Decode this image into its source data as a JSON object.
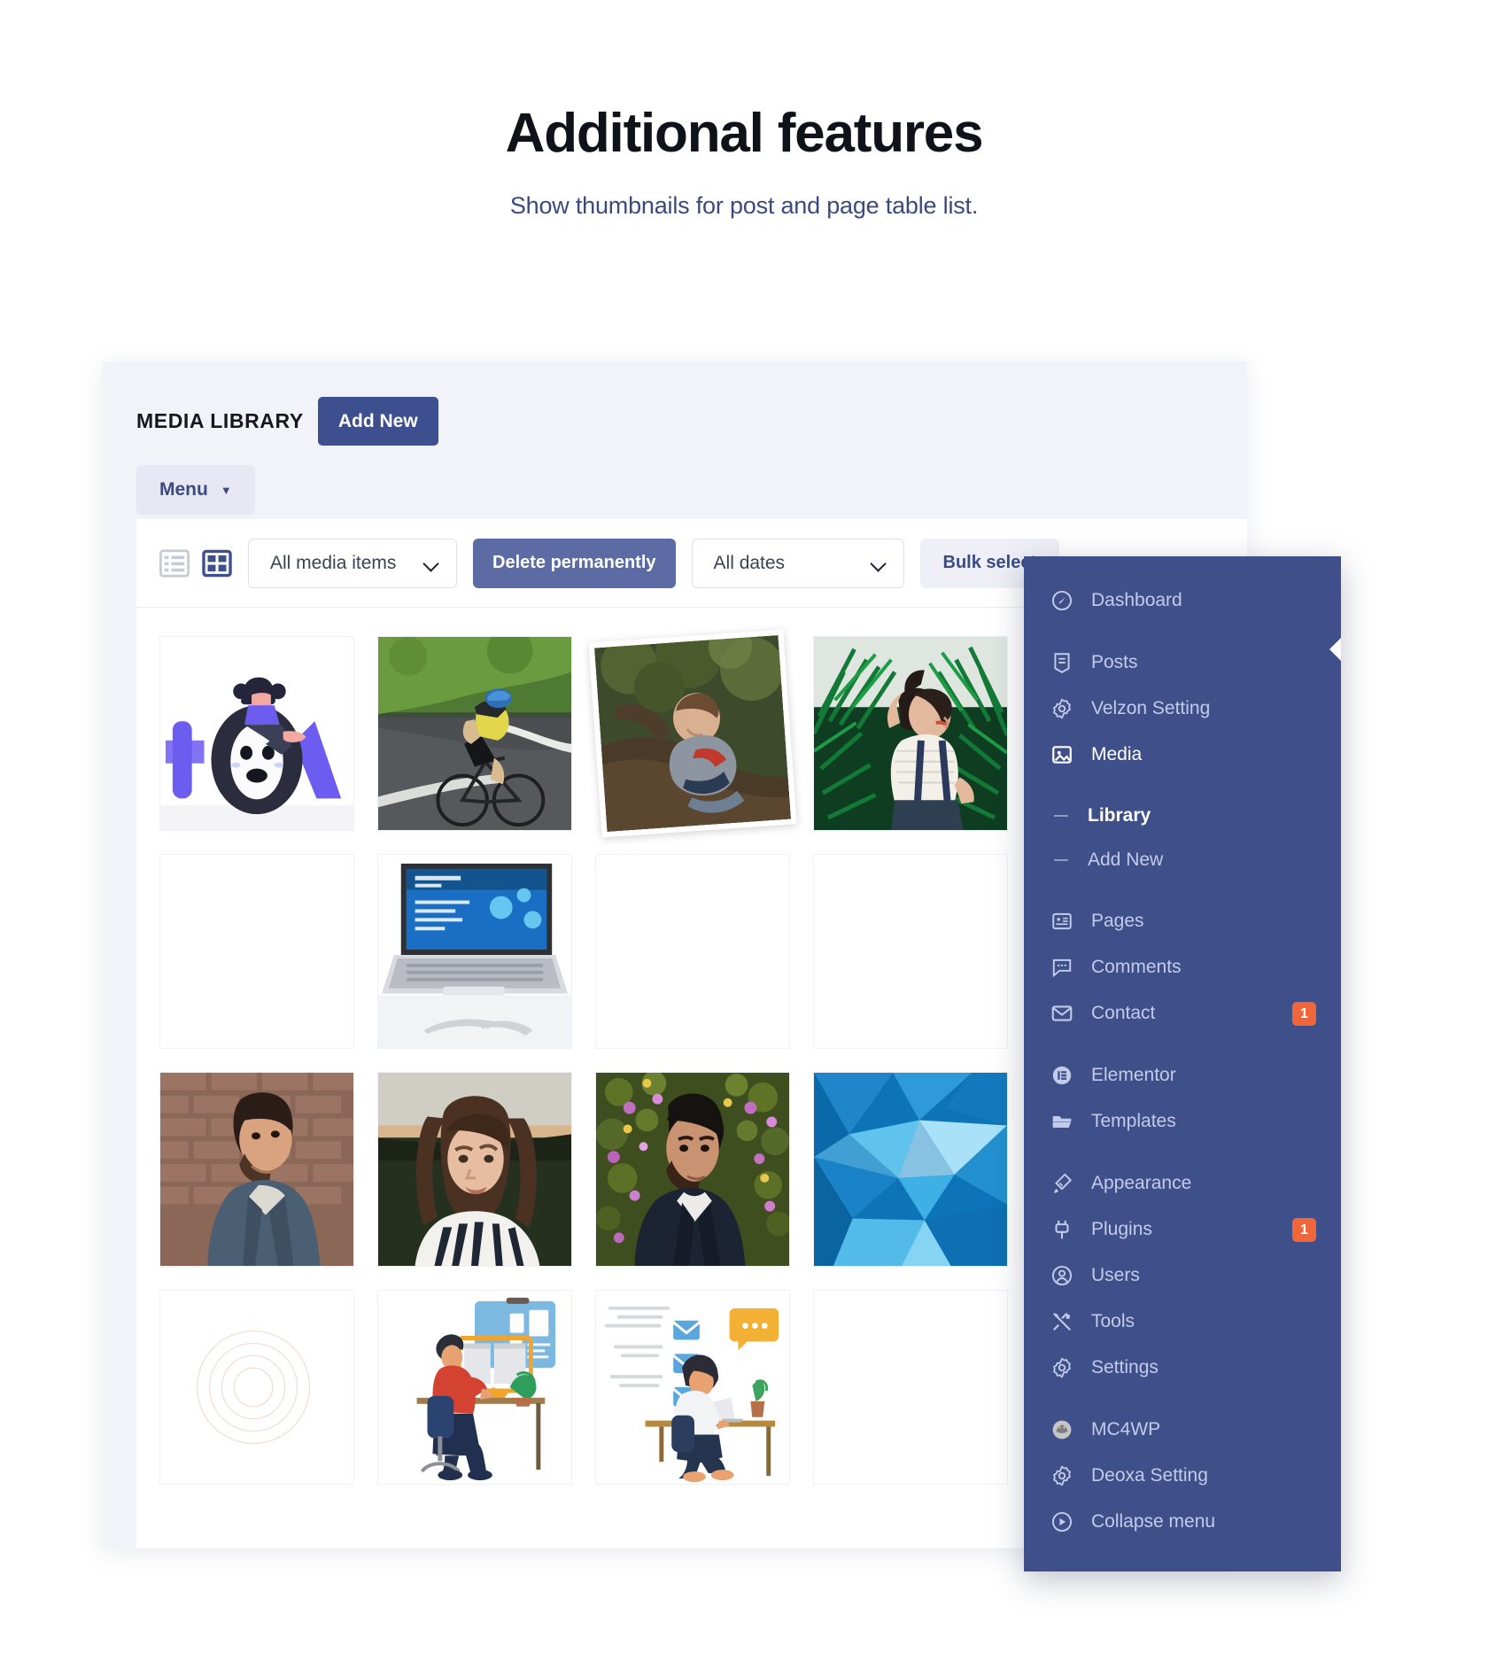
{
  "hero": {
    "title": "Additional features",
    "subtitle": "Show thumbnails for post and page table list."
  },
  "colors": {
    "brand": "#3e4f8f",
    "sidebar": "#3f4f8a",
    "badge": "#f1653a",
    "panel_bg": "#f2f3f9",
    "subtitle": "#3b4a7e"
  },
  "screenshot": {
    "header": {
      "title": "MEDIA LIBRARY",
      "add_new_label": "Add New",
      "menu_label": "Menu"
    },
    "filters": {
      "view_list_icon": "list-view-icon",
      "view_grid_icon": "grid-view-icon",
      "media_filter_value": "All media items",
      "delete_label": "Delete permanently",
      "dates_filter_value": "All dates",
      "bulk_select_label": "Bulk select"
    },
    "grid": {
      "items": [
        {
          "name": "illustration-404-character",
          "type": "illustration"
        },
        {
          "name": "photo-cyclist-road",
          "type": "photo"
        },
        {
          "name": "photo-boy-on-tree",
          "type": "photo",
          "tilted": true
        },
        {
          "name": "photo-woman-in-palms",
          "type": "photo"
        },
        {
          "name": "thumbnail-blank-1",
          "type": "blank"
        },
        {
          "name": "thumbnail-blank-2",
          "type": "blank"
        },
        {
          "name": "photo-laptop-mockup",
          "type": "photo"
        },
        {
          "name": "thumbnail-blank-3",
          "type": "blank"
        },
        {
          "name": "thumbnail-blank-4",
          "type": "blank"
        },
        {
          "name": "thumbnail-blank-5",
          "type": "blank"
        },
        {
          "name": "photo-man-brick-wall",
          "type": "photo"
        },
        {
          "name": "photo-woman-portrait",
          "type": "photo"
        },
        {
          "name": "photo-man-flowers",
          "type": "photo"
        },
        {
          "name": "photo-blue-abstract-polygons",
          "type": "photo"
        },
        {
          "name": "thumbnail-blank-6",
          "type": "blank"
        },
        {
          "name": "thumbnail-faint-circles",
          "type": "blank"
        },
        {
          "name": "illustration-man-at-desk",
          "type": "illustration"
        },
        {
          "name": "illustration-woman-at-desk",
          "type": "illustration"
        },
        {
          "name": "thumbnail-blank-7",
          "type": "blank"
        },
        {
          "name": "thumbnail-blank-8",
          "type": "blank"
        }
      ]
    }
  },
  "sidebar": {
    "items": [
      {
        "label": "Dashboard",
        "icon": "dashboard-icon",
        "type": "item"
      },
      {
        "label": "",
        "type": "gap"
      },
      {
        "label": "Posts",
        "icon": "posts-icon",
        "type": "item"
      },
      {
        "label": "Velzon Setting",
        "icon": "settings-gear-icon",
        "type": "item"
      },
      {
        "label": "Media",
        "icon": "media-image-icon",
        "type": "item",
        "active": true
      },
      {
        "label": "",
        "type": "gap"
      },
      {
        "label": "Library",
        "type": "sub",
        "current": true
      },
      {
        "label": "Add New",
        "type": "sub"
      },
      {
        "label": "",
        "type": "gap"
      },
      {
        "label": "Pages",
        "icon": "pages-icon",
        "type": "item"
      },
      {
        "label": "Comments",
        "icon": "comments-icon",
        "type": "item"
      },
      {
        "label": "Contact",
        "icon": "mail-icon",
        "type": "item",
        "badge": "1"
      },
      {
        "label": "",
        "type": "gap"
      },
      {
        "label": "Elementor",
        "icon": "elementor-icon",
        "type": "item"
      },
      {
        "label": "Templates",
        "icon": "folder-icon",
        "type": "item"
      },
      {
        "label": "",
        "type": "gap"
      },
      {
        "label": "Appearance",
        "icon": "brush-icon",
        "type": "item"
      },
      {
        "label": "Plugins",
        "icon": "plug-icon",
        "type": "item",
        "badge": "1"
      },
      {
        "label": "Users",
        "icon": "user-circle-icon",
        "type": "item"
      },
      {
        "label": "Tools",
        "icon": "tools-icon",
        "type": "item"
      },
      {
        "label": "Settings",
        "icon": "settings-gear-icon",
        "type": "item"
      },
      {
        "label": "",
        "type": "gap"
      },
      {
        "label": "MC4WP",
        "icon": "mc4wp-icon",
        "type": "item"
      },
      {
        "label": "Deoxa Setting",
        "icon": "settings-gear-icon",
        "type": "item"
      },
      {
        "label": "Collapse menu",
        "icon": "collapse-icon",
        "type": "item"
      }
    ]
  }
}
